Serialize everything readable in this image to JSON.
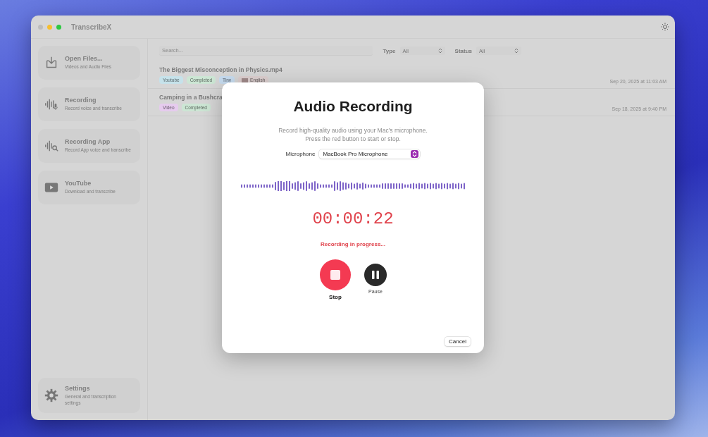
{
  "window": {
    "title": "TranscribeX"
  },
  "sidebar": {
    "items": [
      {
        "kind": "open",
        "title": "Open Files...",
        "subtitle": "Videos and Audio Files"
      },
      {
        "kind": "recording",
        "title": "Recording",
        "subtitle": "Record voice and transcribe"
      },
      {
        "kind": "recording_app",
        "title": "Recording App",
        "subtitle": "Record App voice and transcribe"
      },
      {
        "kind": "youtube",
        "title": "YouTube",
        "subtitle": "Download and transcribe"
      }
    ],
    "footer_item": {
      "kind": "settings",
      "title": "Settings",
      "subtitle": "General and transcription settings"
    }
  },
  "toolbar": {
    "search": {
      "placeholder": "Search..."
    },
    "filters": [
      {
        "label": "Type",
        "value": "All"
      },
      {
        "label": "Status",
        "value": "All"
      }
    ]
  },
  "files": [
    {
      "title": "The Biggest Misconception in Physics.mp4",
      "date": "Sep 20, 2025 at 11:03 AM",
      "tags": [
        {
          "kind": "text",
          "text": "Youtube",
          "color": "#c6e2ea"
        },
        {
          "kind": "text",
          "text": "Completed",
          "color": "#cce6d4"
        },
        {
          "kind": "text",
          "text": "Tiny",
          "color": "#c6dbef"
        },
        {
          "kind": "flag",
          "text": "English",
          "color": "#dccfcf"
        }
      ]
    },
    {
      "title": "Camping in a Bushcra",
      "date": "Sep 18, 2025 at 9:40 PM",
      "tags": [
        {
          "kind": "text",
          "text": "Video",
          "color": "#e6cbee"
        },
        {
          "kind": "text",
          "text": "Completed",
          "color": "#cce6d4"
        }
      ]
    }
  ],
  "dialog": {
    "title": "Audio Recording",
    "description_lines": [
      "Record high-quality audio using your Mac’s microphone.",
      "Press the red button to start or stop."
    ],
    "microphone": {
      "label": "Microphone",
      "value": "MacBook Pro Microphone"
    },
    "timer": "00:00:22",
    "status": "Recording in progress...",
    "controls": [
      {
        "kind": "stop",
        "label": "Stop"
      },
      {
        "kind": "pause",
        "label": "Pause"
      }
    ],
    "cancel": "Cancel"
  }
}
